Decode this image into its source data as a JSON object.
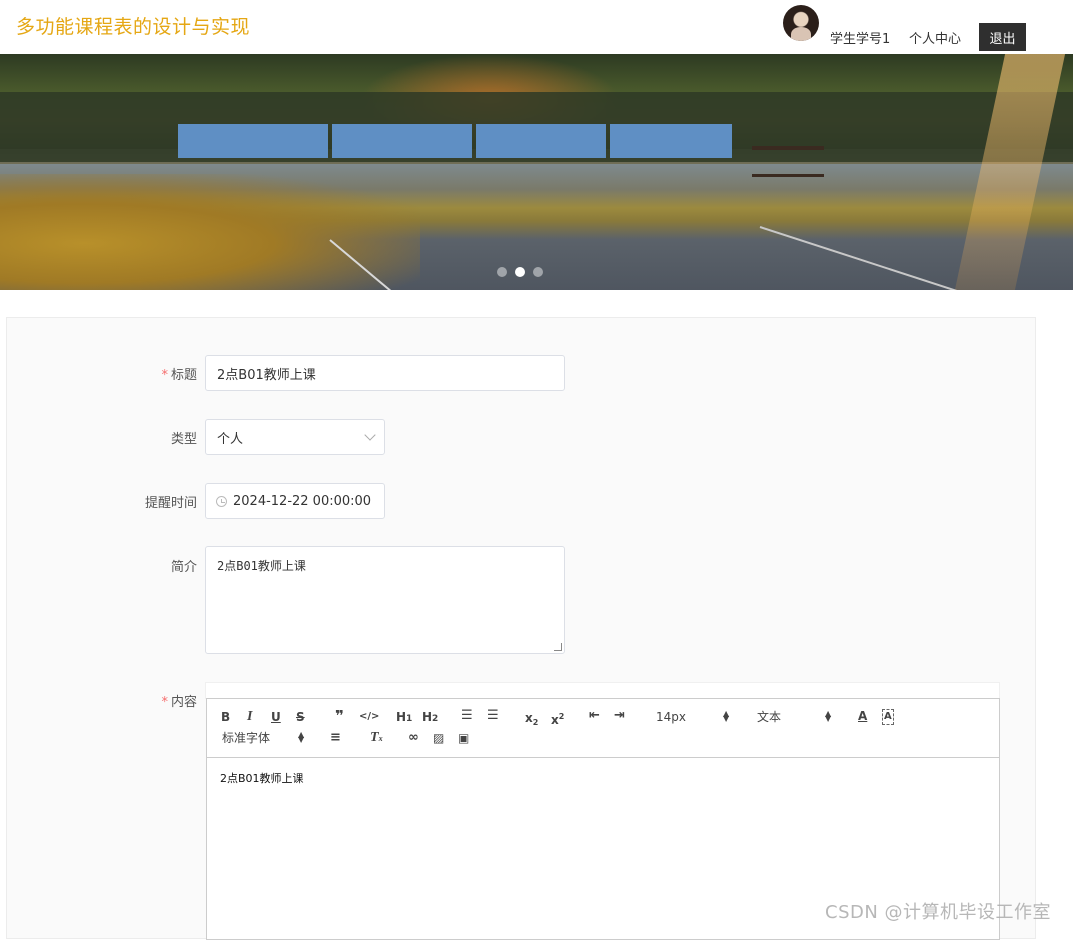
{
  "header": {
    "title": "多功能课程表的设计与实现",
    "username": "学生学号1",
    "profile_label": "个人中心",
    "logout_label": "退出"
  },
  "banner": {
    "slide_count": 3,
    "active_slide": 2
  },
  "form": {
    "title_label": "标题",
    "title_value": "2点B01教师上课",
    "type_label": "类型",
    "type_value": "个人",
    "time_label": "提醒时间",
    "time_value": "2024-12-22 00:00:00",
    "intro_label": "简介",
    "intro_value": "2点B01教师上课",
    "content_label": "内容",
    "required_mark": "*"
  },
  "editor": {
    "font_size": "14px",
    "header_select": "文本",
    "font_family": "标准字体",
    "content": "2点B01教师上课",
    "buttons": [
      "B",
      "I",
      "U",
      "S",
      "quote",
      "code",
      "H1",
      "H2",
      "ordered-list",
      "bullet-list",
      "subscript",
      "superscript",
      "outdent",
      "indent",
      "font-color",
      "background-color",
      "align",
      "clean",
      "link",
      "image",
      "video"
    ]
  },
  "watermark": "CSDN @计算机毕设工作室",
  "colors": {
    "title": "#e5a714",
    "required": "#f56c6c",
    "logout_bg": "#2f2f2f"
  }
}
